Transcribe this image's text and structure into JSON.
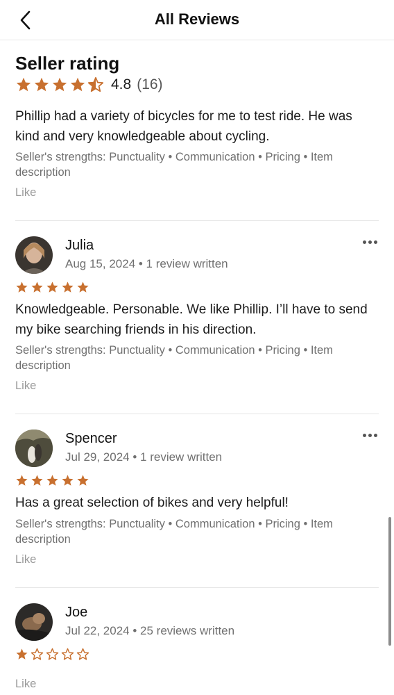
{
  "header": {
    "title": "All Reviews",
    "back_icon": "chevron-left-icon"
  },
  "seller": {
    "title": "Seller rating",
    "rating": "4.8",
    "count": "(16)",
    "stars_filled": 4.5,
    "comment": "Phillip had a variety of bicycles for me to test ride. He was kind and very knowledgeable about cycling.",
    "strengths": "Seller's strengths: Punctuality • Communication • Pricing • Item description",
    "like_label": "Like"
  },
  "reviews": [
    {
      "name": "Julia",
      "subtitle": "Aug 15, 2024 • 1 review written",
      "stars": 5,
      "text": "Knowledgeable. Personable. We like Phillip. I’ll have to send my bike searching friends in his direction.",
      "strengths": "Seller's strengths: Punctuality • Communication • Pricing • Item description",
      "like_label": "Like"
    },
    {
      "name": "Spencer",
      "subtitle": "Jul 29, 2024 • 1 review written",
      "stars": 5,
      "text": "Has a great selection of bikes and very helpful!",
      "strengths": "Seller's strengths: Punctuality • Communication • Pricing • Item description",
      "like_label": "Like"
    },
    {
      "name": "Joe",
      "subtitle": "Jul 22, 2024 • 25 reviews written",
      "stars": 1,
      "text": "",
      "strengths": "",
      "like_label": "Like"
    }
  ],
  "colors": {
    "star": "#c8702f",
    "accent_text": "#1c1c1c",
    "muted": "#707070"
  }
}
